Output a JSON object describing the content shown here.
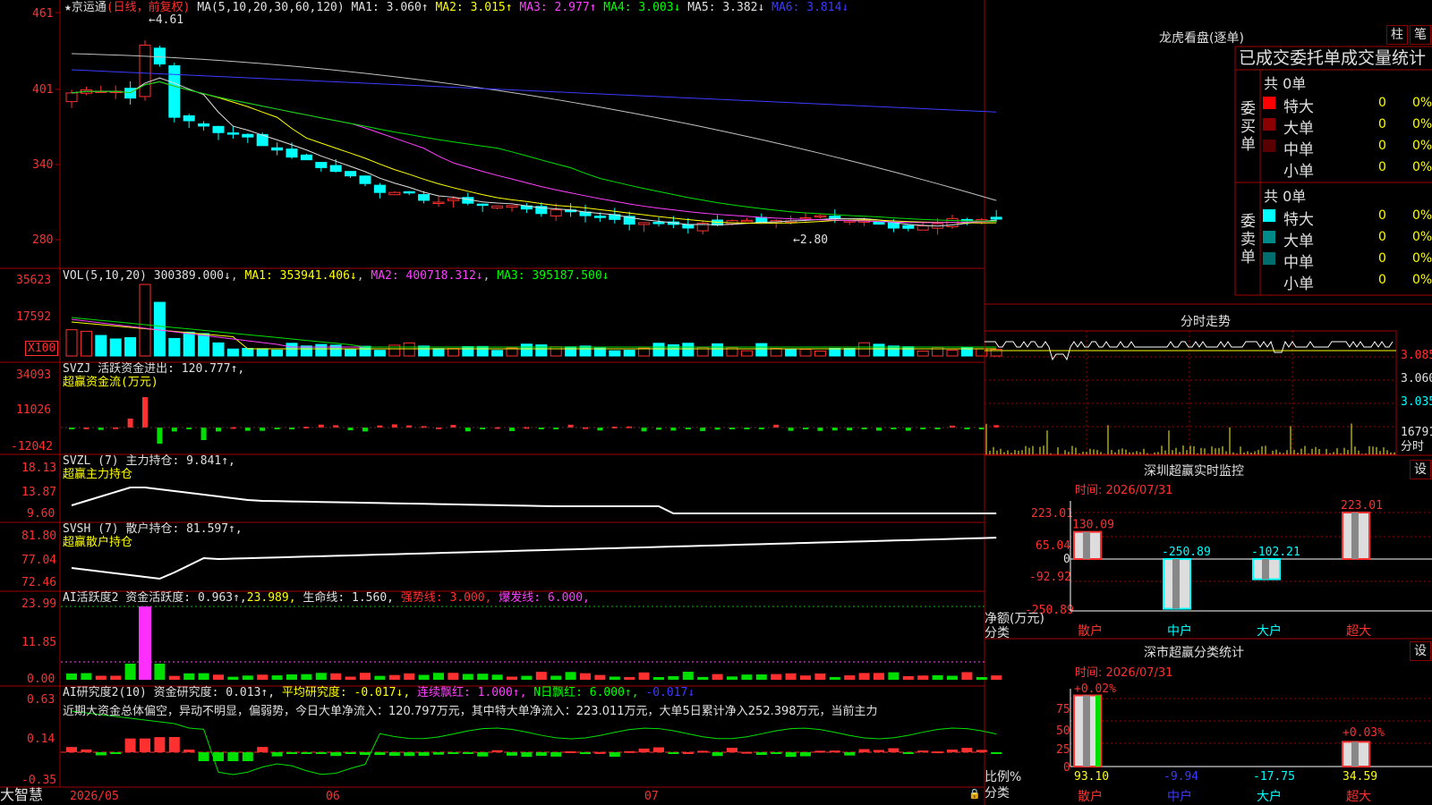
{
  "colors": {
    "up": "#ff3030",
    "down": "#00ffff",
    "frame": "#a00000",
    "ma1": "#e0e0e0",
    "ma2": "#ffff00",
    "ma3": "#ff40ff",
    "ma4": "#00e000",
    "ma5": "#c0c0c0",
    "ma6": "#3b3bff"
  },
  "header": {
    "star": "★",
    "stock_name": "京运通",
    "period": "(日线，前复权)",
    "ma_spec": "MA(5,10,20,30,60,120)",
    "ma1": "MA1: 3.060↑",
    "ma2": "MA2: 3.015↑",
    "ma3": "MA3: 2.977↑",
    "ma4": "MA4: 3.003↓",
    "ma5": "MA5: 3.382↓",
    "ma6": "MA6: 3.814↓",
    "high_mark": "←4.61",
    "low_mark": "←2.80"
  },
  "price_axis": {
    "t1": "461",
    "t2": "401",
    "t3": "340",
    "t4": "280"
  },
  "vol": {
    "title": "VOL(5,10,20) 300389.000↓",
    "ma1": "MA1: 353941.406↓",
    "ma2": "MA2: 400718.312↓",
    "ma3": "MA3: 395187.500↓",
    "t1": "35623",
    "t2": "17592",
    "unit": "X100"
  },
  "svzj": {
    "line1": "SVZJ  活跃资金进出: 120.777↑,",
    "line2": "超赢资金流(万元)",
    "t1": "34093",
    "t2": "11026",
    "t3": "-12042"
  },
  "svzl": {
    "line1": "SVZL (7) 主力持仓: 9.841↑,",
    "line2": "超赢主力持仓",
    "t1": "18.13",
    "t2": "13.87",
    "t3": "9.60"
  },
  "svsh": {
    "line1": "SVSH (7) 散户持仓: 81.597↑,",
    "line2": "超赢散户持仓",
    "t1": "81.80",
    "t2": "77.04",
    "t3": "72.46"
  },
  "ai1": {
    "prefix": "AI活跃度2 资金活跃度: 0.963↑,",
    "v2": "23.989,",
    "v3": "生命线: 1.560,",
    "v4": "强势线: 3.000,",
    "v5": "爆发线: 6.000,",
    "t1": "23.99",
    "t2": "11.85",
    "t3": "0.00"
  },
  "ai2": {
    "prefix": "AI研究度2(10) 资金研究度: 0.013↑,",
    "v2": "平均研究度: -0.017↓,",
    "v3": "连续飘红: 1.000↑,",
    "v4": "N日飘红: 6.000↑,",
    "v5": "-0.017↓",
    "desc": "近期大资金总体偏空，异动不明显，偏弱势，今日大单净流入：120.797万元，其中特大单净流入：223.011万元，大单5日累计净入252.398万元，当前主力",
    "t1": "0.63",
    "t2": "0.14",
    "t3": "-0.35"
  },
  "date_axis": {
    "brand": "大智慧",
    "d1": "2026/05",
    "d2": "06",
    "d3": "07"
  },
  "dragon": {
    "title": "龙虎看盘(逐单)",
    "btn1": "柱",
    "btn2": "笔",
    "subtitle": "已成交委托单成交量统计",
    "buy": {
      "label": "委买单",
      "total": "共 0单",
      "rows": [
        {
          "name": "特大",
          "v": "0",
          "p": "0%",
          "color": "#ff0000"
        },
        {
          "name": "大单",
          "v": "0",
          "p": "0%",
          "color": "#8b0000"
        },
        {
          "name": "中单",
          "v": "0",
          "p": "0%",
          "color": "#5a0000"
        },
        {
          "name": "小单",
          "v": "0",
          "p": "0%",
          "color": ""
        }
      ]
    },
    "sell": {
      "label": "委卖单",
      "total": "共 0单",
      "rows": [
        {
          "name": "特大",
          "v": "0",
          "p": "0%",
          "color": "#00ffff"
        },
        {
          "name": "大单",
          "v": "0",
          "p": "0%",
          "color": "#008b8b"
        },
        {
          "name": "中单",
          "v": "0",
          "p": "0%",
          "color": "#006e6e"
        },
        {
          "name": "小单",
          "v": "0",
          "p": "0%",
          "color": ""
        }
      ]
    }
  },
  "minute": {
    "title": "分时走势",
    "p1": "3.085",
    "p2": "3.060",
    "p3": "3.035",
    "vol": "16791",
    "unit": "分时"
  },
  "monitor": {
    "title": "深圳超赢实时监控",
    "btn": "设",
    "time": "时间: 2026/07/31",
    "axis": {
      "t1": "223.01",
      "t2": "65.04",
      "t3": "0",
      "t4": "-92.92",
      "t5": "-250.89"
    },
    "ylabel": "净额(万元)",
    "xlabel": "分类",
    "bars": [
      {
        "cat": "散户",
        "value": 130.09,
        "label": "130.09"
      },
      {
        "cat": "中户",
        "value": -250.89,
        "label": "-250.89"
      },
      {
        "cat": "大户",
        "value": -102.21,
        "label": "-102.21"
      },
      {
        "cat": "超大",
        "value": 223.01,
        "label": "223.01"
      }
    ]
  },
  "classify": {
    "title": "深市超赢分类统计",
    "btn": "设",
    "time": "时间: 2026/07/31",
    "axis": {
      "t1": "75",
      "t2": "50",
      "t3": "25",
      "t4": "0"
    },
    "ylabel": "比例%",
    "xlabel": "分类",
    "top1": "+0.02%",
    "top4": "+0.03%",
    "bars": [
      {
        "cat": "散户",
        "value": 93.1,
        "label": "93.10"
      },
      {
        "cat": "中户",
        "value": -9.94,
        "label": "-9.94"
      },
      {
        "cat": "大户",
        "value": -17.75,
        "label": "-17.75"
      },
      {
        "cat": "超大",
        "value": 34.59,
        "label": "34.59"
      }
    ]
  }
}
